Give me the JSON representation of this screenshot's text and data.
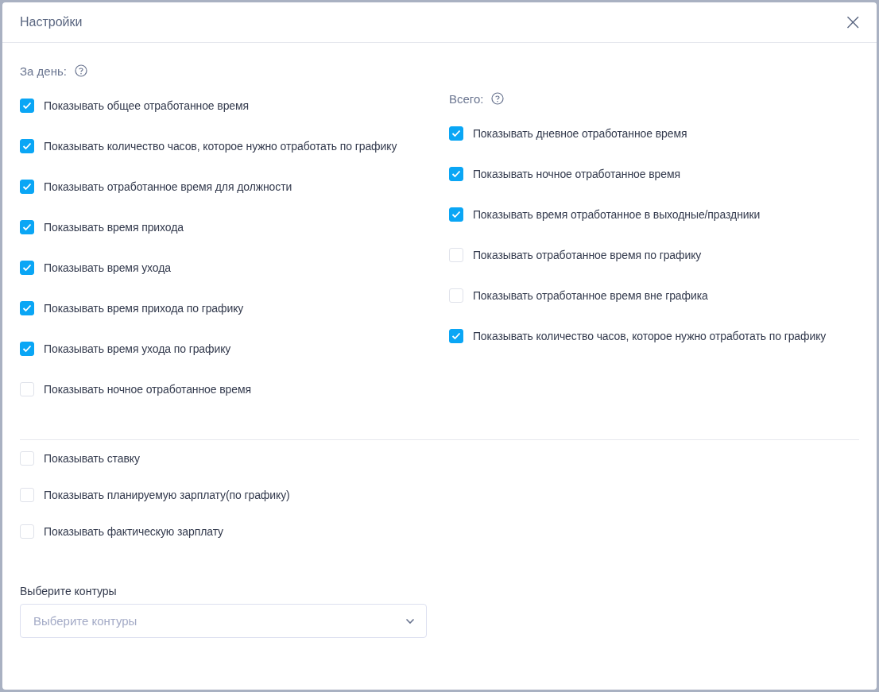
{
  "dialog": {
    "title": "Настройки",
    "close": "×"
  },
  "day": {
    "heading": "За день:",
    "options": [
      {
        "label": "Показывать общее отработанное время",
        "checked": true
      },
      {
        "label": "Показывать количество часов, которое нужно отработать по графику",
        "checked": true
      },
      {
        "label": "Показывать отработанное время для должности",
        "checked": true
      },
      {
        "label": "Показывать время прихода",
        "checked": true
      },
      {
        "label": "Показывать время ухода",
        "checked": true
      },
      {
        "label": "Показывать время прихода по графику",
        "checked": true
      },
      {
        "label": "Показывать время ухода по графику",
        "checked": true
      },
      {
        "label": "Показывать ночное отработанное время",
        "checked": false
      }
    ]
  },
  "total": {
    "heading": "Всего:",
    "options": [
      {
        "label": "Показывать дневное отработанное время",
        "checked": true
      },
      {
        "label": "Показывать ночное отработанное время",
        "checked": true
      },
      {
        "label": "Показывать время отработанное в выходные/праздники",
        "checked": true
      },
      {
        "label": "Показывать отработанное время по графику",
        "checked": false
      },
      {
        "label": "Показывать отработанное время вне графика",
        "checked": false
      },
      {
        "label": "Показывать количество часов, которое нужно отработать по графику",
        "checked": true
      }
    ]
  },
  "salary_options": [
    {
      "label": "Показывать ставку",
      "checked": false
    },
    {
      "label": "Показывать планируемую зарплату(по графику)",
      "checked": false
    },
    {
      "label": "Показывать фактическую зарплату",
      "checked": false
    }
  ],
  "contours": {
    "label": "Выберите контуры",
    "placeholder": "Выберите контуры"
  }
}
